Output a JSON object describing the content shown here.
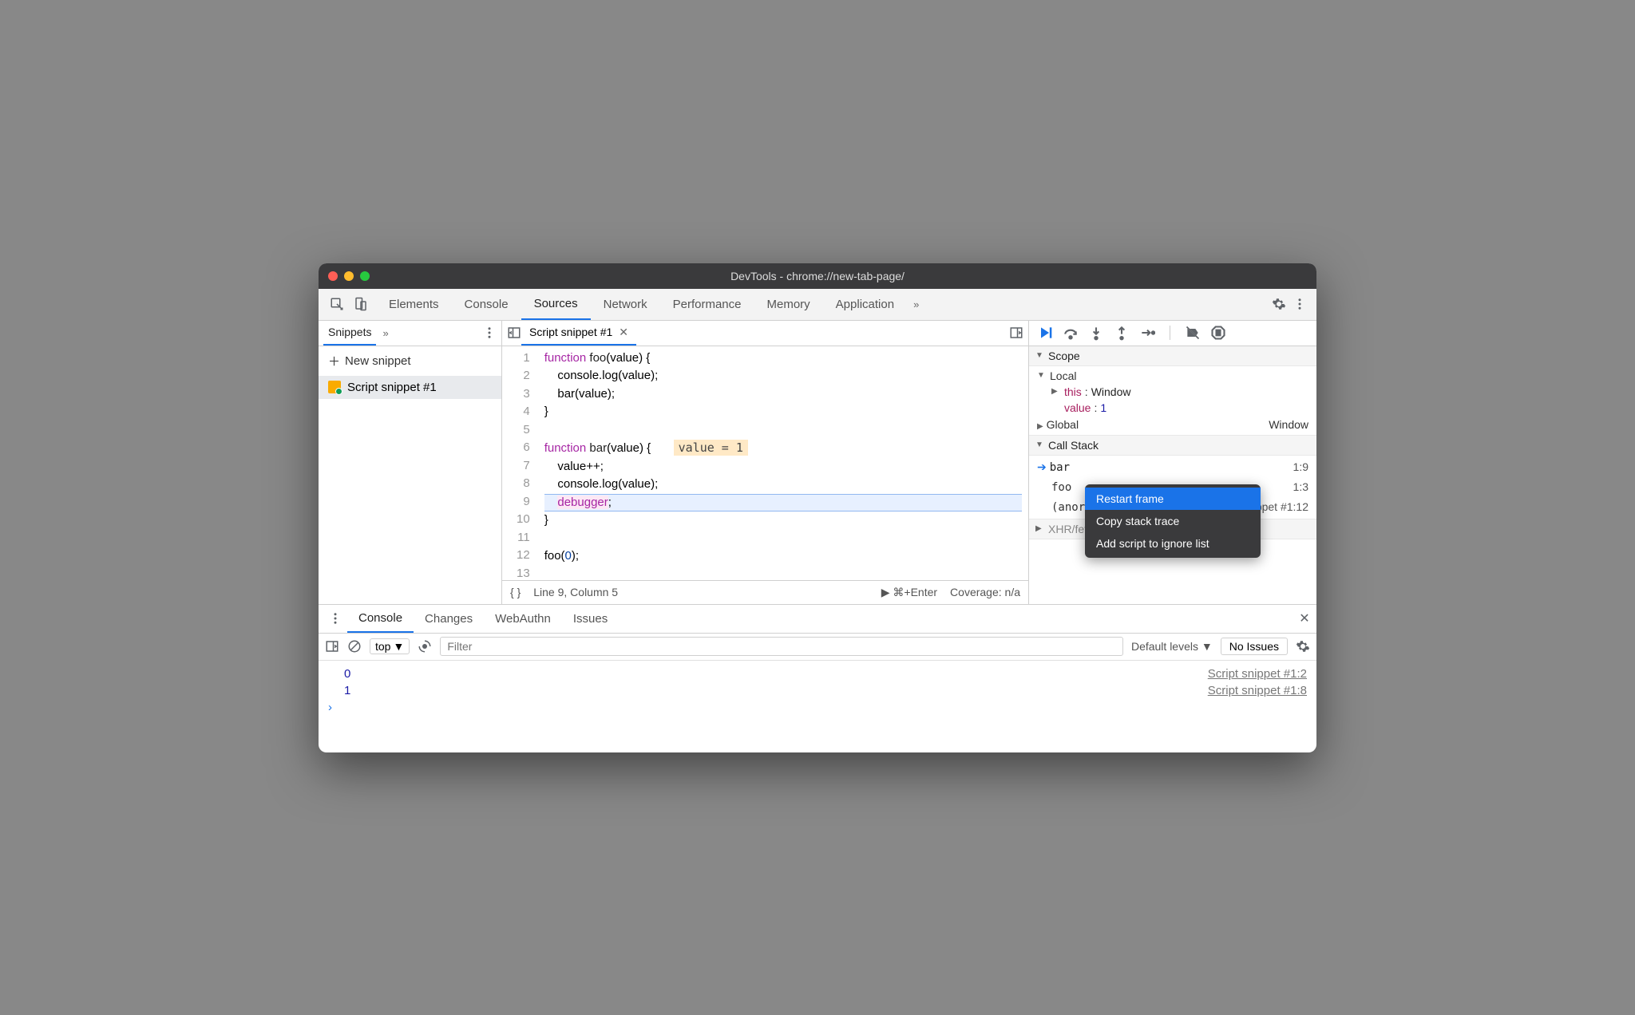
{
  "window": {
    "title": "DevTools - chrome://new-tab-page/"
  },
  "mainTabs": [
    "Elements",
    "Console",
    "Sources",
    "Network",
    "Performance",
    "Memory",
    "Application"
  ],
  "mainTabsActive": "Sources",
  "sidebar": {
    "tab": "Snippets",
    "newSnippet": "New snippet",
    "snippet": "Script snippet #1"
  },
  "editor": {
    "tab": "Script snippet #1",
    "lines": [
      1,
      2,
      3,
      4,
      5,
      6,
      7,
      8,
      9,
      10,
      11,
      12,
      13
    ],
    "inlineValue": "value = 1"
  },
  "status": {
    "pos": "Line 9, Column 5",
    "run": "⌘+Enter",
    "coverage": "Coverage: n/a"
  },
  "debugger": {
    "scope": {
      "title": "Scope",
      "local": "Local",
      "thisKey": "this",
      "thisVal": "Window",
      "valueKey": "value",
      "valueVal": "1",
      "global": "Global",
      "globalVal": "Window"
    },
    "callstack": {
      "title": "Call Stack",
      "frames": [
        {
          "fn": "bar",
          "loc": "1:9"
        },
        {
          "fn": "foo",
          "loc": "1:3"
        },
        {
          "fn": "(anor",
          "loc": "Script snippet #1:12"
        }
      ],
      "xhr": "XHR/fetch Breakpoints"
    },
    "contextMenu": [
      "Restart frame",
      "Copy stack trace",
      "Add script to ignore list"
    ]
  },
  "drawer": {
    "tabs": [
      "Console",
      "Changes",
      "WebAuthn",
      "Issues"
    ],
    "active": "Console",
    "context": "top",
    "filterPlaceholder": "Filter",
    "levels": "Default levels",
    "noIssues": "No Issues",
    "logs": [
      {
        "val": "0",
        "src": "Script snippet #1:2"
      },
      {
        "val": "1",
        "src": "Script snippet #1:8"
      }
    ]
  }
}
